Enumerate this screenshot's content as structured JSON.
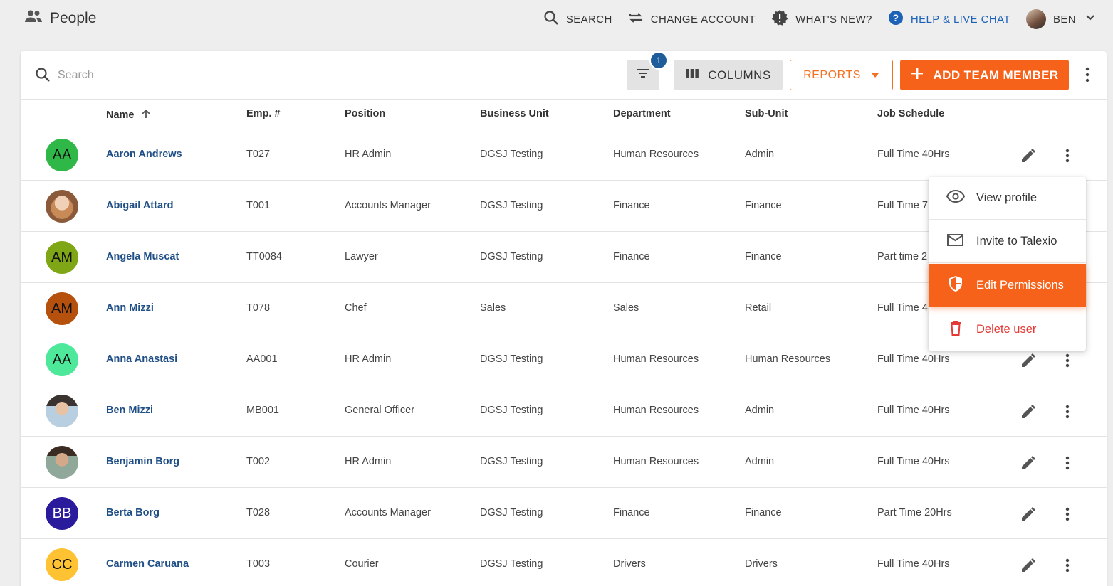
{
  "header": {
    "title": "People",
    "nav": [
      {
        "label": "SEARCH",
        "icon": "search-icon"
      },
      {
        "label": "CHANGE ACCOUNT",
        "icon": "swap-icon"
      },
      {
        "label": "WHAT'S NEW?",
        "icon": "badge-alert-icon"
      },
      {
        "label": "HELP & LIVE CHAT",
        "icon": "help-circle-icon",
        "color": "#1e62b7"
      }
    ],
    "user": "BEN"
  },
  "toolbar": {
    "search_placeholder": "Search",
    "filter_badge": "1",
    "columns_label": "COLUMNS",
    "reports_label": "REPORTS",
    "add_label": "ADD TEAM MEMBER"
  },
  "colors": {
    "accent": "#f6621a",
    "link": "#1f4f86",
    "badge": "#1e5c9a",
    "danger": "#e53935"
  },
  "table": {
    "headers": [
      "Name",
      "Emp. #",
      "Position",
      "Business Unit",
      "Department",
      "Sub-Unit",
      "Job Schedule"
    ],
    "sort": {
      "column": "Name",
      "direction": "ascending"
    },
    "rows": [
      {
        "initials": "AA",
        "avatar_color": "#2fb847",
        "name": "Aaron Andrews",
        "emp": "T027",
        "position": "HR Admin",
        "bu": "DGSJ Testing",
        "dept": "Human Resources",
        "sub": "Admin",
        "schedule": "Full Time 40Hrs"
      },
      {
        "initials": "",
        "avatar_color": "photo",
        "name": "Abigail Attard",
        "emp": "T001",
        "position": "Accounts Manager",
        "bu": "DGSJ Testing",
        "dept": "Finance",
        "sub": "Finance",
        "schedule": "Full Time 7"
      },
      {
        "initials": "AM",
        "avatar_color": "#7fa615",
        "name": "Angela Muscat",
        "emp": "TT0084",
        "position": "Lawyer",
        "bu": "DGSJ Testing",
        "dept": "Finance",
        "sub": "Finance",
        "schedule": "Part time 2"
      },
      {
        "initials": "AM",
        "avatar_color": "#b5510d",
        "name": "Ann Mizzi",
        "emp": "T078",
        "position": "Chef",
        "bu": "Sales",
        "dept": "Sales",
        "sub": "Retail",
        "schedule": "Full Time 4"
      },
      {
        "initials": "AA",
        "avatar_color": "#4de89a",
        "name": "Anna Anastasi",
        "emp": "AA001",
        "position": "HR Admin",
        "bu": "DGSJ Testing",
        "dept": "Human Resources",
        "sub": "Human Resources",
        "schedule": "Full Time 40Hrs"
      },
      {
        "initials": "",
        "avatar_color": "photo",
        "name": "Ben Mizzi",
        "emp": "MB001",
        "position": "General Officer",
        "bu": "DGSJ Testing",
        "dept": "Human Resources",
        "sub": "Admin",
        "schedule": "Full Time 40Hrs"
      },
      {
        "initials": "",
        "avatar_color": "photo",
        "name": "Benjamin Borg",
        "emp": "T002",
        "position": "HR Admin",
        "bu": "DGSJ Testing",
        "dept": "Human Resources",
        "sub": "Admin",
        "schedule": "Full Time 40Hrs"
      },
      {
        "initials": "BB",
        "avatar_color": "#2a1a9c",
        "name": "Berta Borg",
        "emp": "T028",
        "position": "Accounts Manager",
        "bu": "DGSJ Testing",
        "dept": "Finance",
        "sub": "Finance",
        "schedule": "Part Time 20Hrs"
      },
      {
        "initials": "CC",
        "avatar_color": "#ffc233",
        "name": "Carmen Caruana",
        "emp": "T003",
        "position": "Courier",
        "bu": "DGSJ Testing",
        "dept": "Drivers",
        "sub": "Drivers",
        "schedule": "Full Time 40Hrs"
      }
    ]
  },
  "context_menu": {
    "items": [
      {
        "label": "View profile",
        "icon": "eye-icon"
      },
      {
        "label": "Invite to Talexio",
        "icon": "mail-icon"
      },
      {
        "label": "Edit Permissions",
        "icon": "shield-icon",
        "active": true
      },
      {
        "label": "Delete user",
        "icon": "trash-icon",
        "danger": true
      }
    ]
  }
}
